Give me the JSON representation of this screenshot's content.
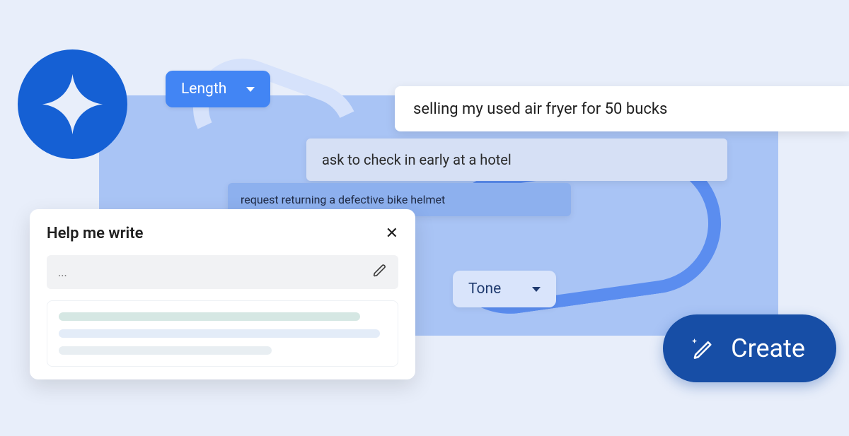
{
  "length_dropdown": {
    "label": "Length"
  },
  "tone_dropdown": {
    "label": "Tone"
  },
  "prompt_bar": {
    "value": "selling my used air fryer for 50 bucks"
  },
  "suggestions": {
    "mid": "ask to check in early at a hotel",
    "low": "request returning a defective bike helmet"
  },
  "help_panel": {
    "title": "Help me write",
    "input_value": "...",
    "close_label": "✕"
  },
  "create_button": {
    "label": "Create"
  }
}
